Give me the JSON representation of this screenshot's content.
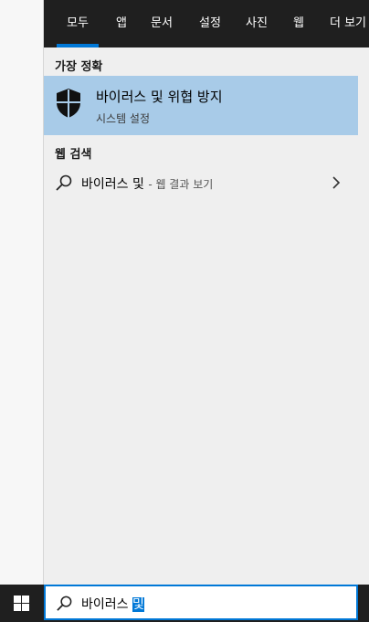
{
  "tabs": [
    {
      "label": "모두",
      "active": true
    },
    {
      "label": "앱"
    },
    {
      "label": "문서"
    },
    {
      "label": "설정"
    },
    {
      "label": "사진"
    },
    {
      "label": "웹"
    },
    {
      "label": "더 보기"
    }
  ],
  "sections": {
    "best_match_title": "가장 정확",
    "web_search_title": "웹 검색"
  },
  "best_match": {
    "title": "바이러스 및 위협 방지",
    "subtitle": "시스템 설정",
    "icon": "shield-icon"
  },
  "web_result": {
    "query": "바이러스 및",
    "suffix": "- 웹 결과 보기",
    "icon": "search-icon"
  },
  "search_box": {
    "text": "바이러스 ",
    "selected_text": "및",
    "icon": "search-icon"
  },
  "colors": {
    "accent": "#0078d7",
    "highlight": "#a8cbe8",
    "tabbar": "#1f1f1f"
  }
}
